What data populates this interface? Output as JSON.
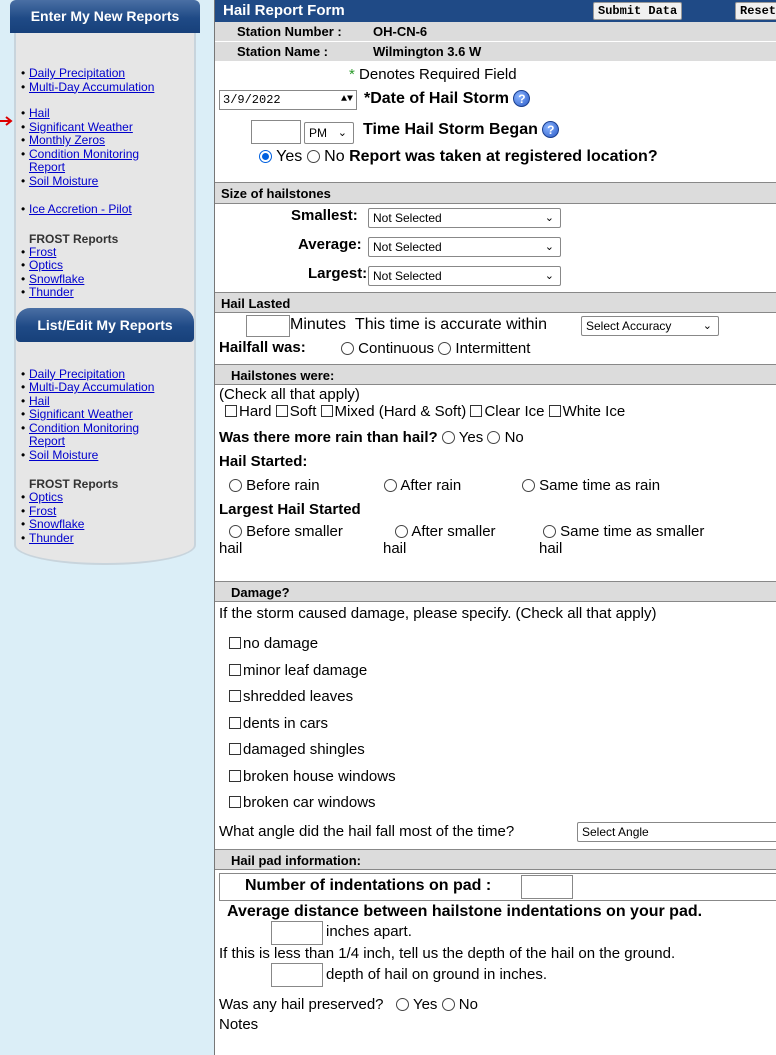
{
  "sidebar": {
    "enter_title": "Enter My New Reports",
    "enter_items": [
      "Daily Precipitation",
      "Multi-Day Accumulation"
    ],
    "enter_items2": [
      "Hail",
      "Significant Weather",
      "Monthly Zeros",
      "Condition Monitoring Report",
      "Soil Moisture"
    ],
    "enter_items3": [
      "Ice Accretion - Pilot"
    ],
    "frost_label": "FROST Reports",
    "enter_frost": [
      "Frost",
      "Optics",
      "Snowflake",
      "Thunder"
    ],
    "list_title": "List/Edit My Reports",
    "list_items": [
      "Daily Precipitation",
      "Multi-Day Accumulation",
      "Hail",
      "Significant Weather",
      "Condition Monitoring Report",
      "Soil Moisture"
    ],
    "list_frost": [
      "Optics",
      "Frost",
      "Snowflake",
      "Thunder"
    ]
  },
  "form": {
    "title": "Hail Report Form",
    "submit": "Submit Data",
    "reset": "Reset",
    "station_number_label": "Station Number :",
    "station_number": "OH-CN-6",
    "station_name_label": "Station Name :",
    "station_name": "Wilmington 3.6 W",
    "required_star": "*",
    "required_note": "Denotes Required Field",
    "date_value": "3/9/2022",
    "date_label": "*Date of Hail Storm",
    "ampm": "PM",
    "time_label": "Time Hail Storm Began",
    "yes": "Yes",
    "no": "No",
    "location_q": "Report was taken at registered location?",
    "size_header": "Size of hailstones",
    "smallest_label": "Smallest:",
    "average_label": "Average:",
    "largest_label": "Largest:",
    "not_selected": "Not Selected",
    "lasted_header": "Hail Lasted",
    "minutes": "Minutes",
    "accuracy_text": "This time is accurate within",
    "accuracy_select": "Select Accuracy",
    "hailfall_label": "Hailfall was:",
    "continuous": "Continuous",
    "intermittent": "Intermittent",
    "hailstones_header": "Hailstones were:",
    "check_all": "(Check all that apply)",
    "types": [
      "Hard",
      "Soft",
      "Mixed (Hard & Soft)",
      "Clear Ice",
      "White Ice"
    ],
    "more_rain_q": "Was there more rain than hail?",
    "hail_started": "Hail Started:",
    "before_rain": "Before rain",
    "after_rain": "After rain",
    "same_rain": "Same time as rain",
    "largest_started": "Largest Hail Started",
    "before_smaller": "Before smaller",
    "after_smaller": "After smaller",
    "same_smaller": "Same time as smaller",
    "hail_word": "hail",
    "damage_header": "Damage?",
    "damage_text": "If the storm caused damage, please specify. (Check all that apply)",
    "damage_items": [
      "no damage",
      "minor leaf damage",
      "shredded leaves",
      "dents in cars",
      "damaged shingles",
      "broken house windows",
      "broken car windows"
    ],
    "angle_q": "What angle did the hail fall most of the time?",
    "angle_select": "Select Angle",
    "pad_header": "Hail pad information:",
    "indent_label": "Number of indentations on pad :",
    "avg_distance": "Average distance between hailstone indentations on your pad.",
    "inches_apart": "inches apart.",
    "depth_q": "If this is less than 1/4 inch, tell us the depth of the hail on the ground.",
    "depth_label": "depth of hail on ground in inches.",
    "preserved_q": "Was any hail preserved?",
    "notes": "Notes"
  }
}
